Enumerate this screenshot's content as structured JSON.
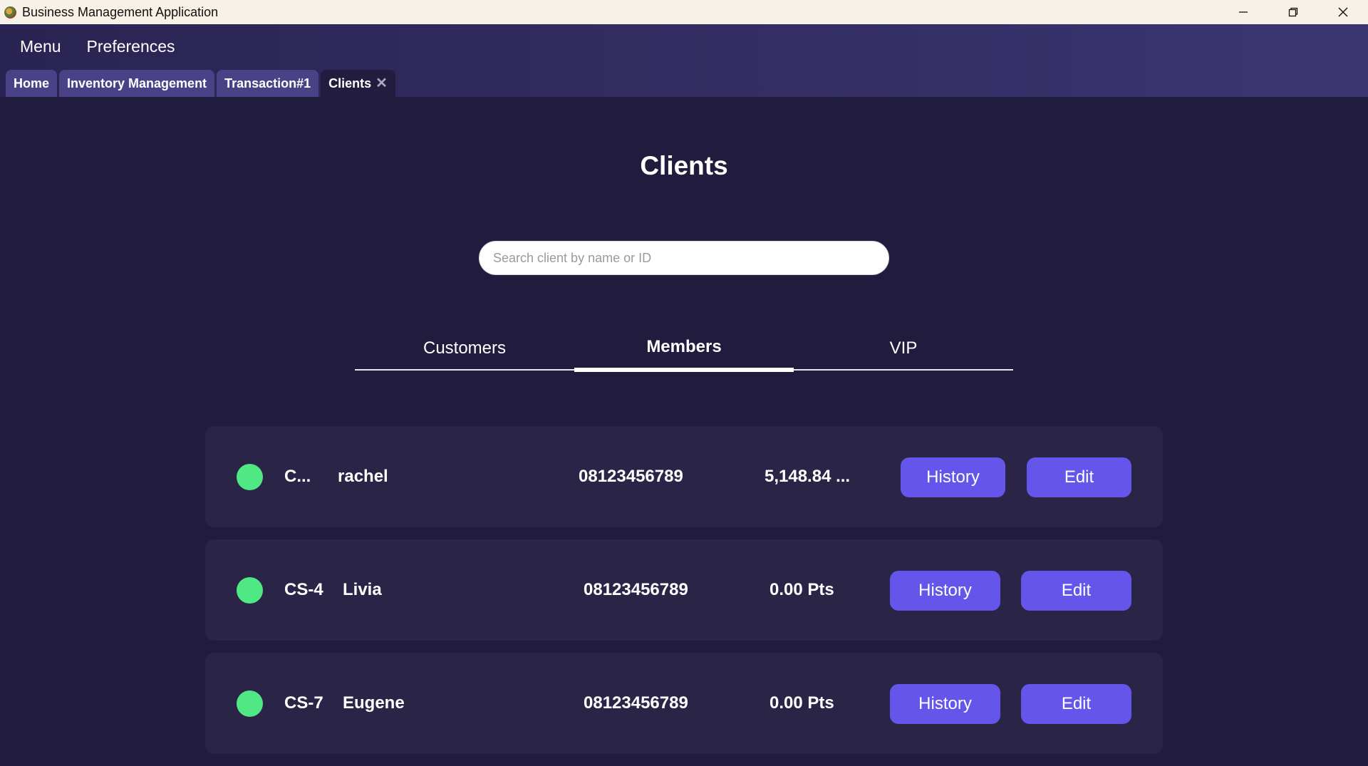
{
  "window": {
    "title": "Business Management Application"
  },
  "menu": {
    "items": [
      "Menu",
      "Preferences"
    ]
  },
  "tabs": [
    {
      "label": "Home"
    },
    {
      "label": "Inventory Management"
    },
    {
      "label": "Transaction#1"
    },
    {
      "label": "Clients",
      "close": "✕"
    }
  ],
  "page": {
    "title": "Clients"
  },
  "search": {
    "placeholder": "Search client by name or ID",
    "value": ""
  },
  "segments": [
    {
      "label": "Customers"
    },
    {
      "label": "Members"
    },
    {
      "label": "VIP"
    }
  ],
  "selected_segment": "Members",
  "clients": [
    {
      "id": "C...",
      "name": "rachel",
      "phone": "08123456789",
      "points": "5,148.84 ...",
      "status_color": "#4fe884",
      "history_label": "History",
      "edit_label": "Edit"
    },
    {
      "id": "CS-4",
      "name": "Livia",
      "phone": "08123456789",
      "points": "0.00 Pts",
      "status_color": "#4fe884",
      "history_label": "History",
      "edit_label": "Edit"
    },
    {
      "id": "CS-7",
      "name": "Eugene",
      "phone": "08123456789",
      "points": "0.00 Pts",
      "status_color": "#4fe884",
      "history_label": "History",
      "edit_label": "Edit"
    }
  ],
  "colors": {
    "accent": "#6655ea",
    "background": "#211c3d",
    "card": "#2a2547",
    "status_active": "#4fe884"
  }
}
